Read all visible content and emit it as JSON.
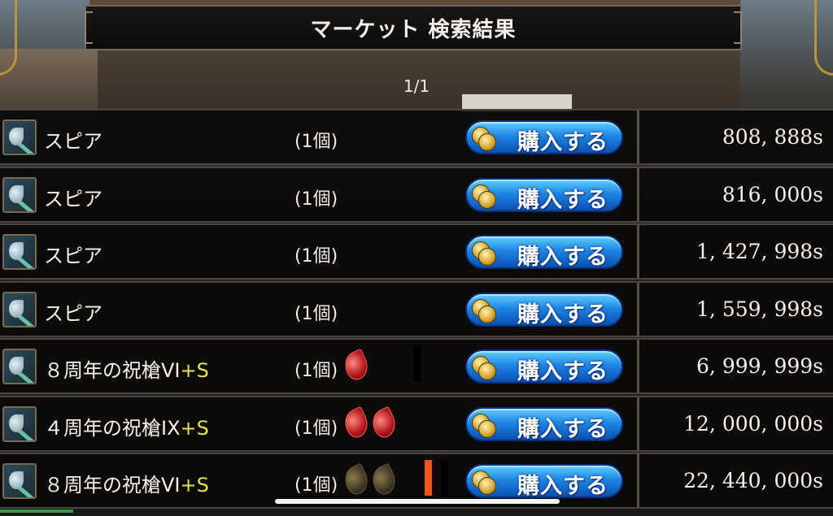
{
  "header": {
    "title": "マーケット 検索結果",
    "page_indicator": "1/1"
  },
  "buy_button_label": "購入する",
  "colors": {
    "accent_plus": "#e7e24a",
    "button_blue": "#1e86e4",
    "gem_red": "#b0151c",
    "gem_dark": "#3a3220",
    "bar_orange": "#f2531b",
    "bar_black": "#000000"
  },
  "listings": [
    {
      "name": "スピア",
      "plus": "",
      "quantity": "(1個)",
      "gems": [],
      "bars": [],
      "price": "808, 888s"
    },
    {
      "name": "スピア",
      "plus": "",
      "quantity": "(1個)",
      "gems": [],
      "bars": [],
      "price": "816, 000s"
    },
    {
      "name": "スピア",
      "plus": "",
      "quantity": "(1個)",
      "gems": [],
      "bars": [],
      "price": "1, 427, 998s"
    },
    {
      "name": "スピア",
      "plus": "",
      "quantity": "(1個)",
      "gems": [],
      "bars": [],
      "price": "1, 559, 998s"
    },
    {
      "name": "８周年の祝槍VI",
      "plus": "+S",
      "quantity": "(1個)",
      "gems": [
        "red"
      ],
      "bars": [
        "black"
      ],
      "price": "6, 999, 999s"
    },
    {
      "name": "４周年の祝槍IX",
      "plus": "+S",
      "quantity": "(1個)",
      "gems": [
        "red",
        "red"
      ],
      "bars": [],
      "price": "12, 000, 000s"
    },
    {
      "name": "８周年の祝槍VI",
      "plus": "+S",
      "quantity": "(1個)",
      "gems": [
        "dark",
        "dark"
      ],
      "bars": [
        "orange",
        "black"
      ],
      "price": "22, 440, 000s"
    }
  ]
}
